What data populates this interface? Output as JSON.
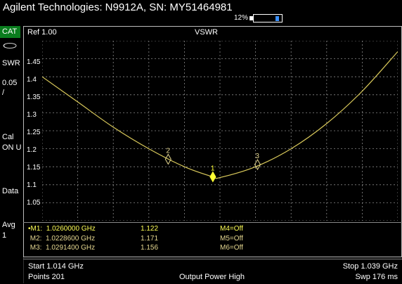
{
  "header": {
    "title": "Agilent Technologies: N9912A, SN: MY51464981",
    "battery_percent": "12%",
    "battery_level": 0.12
  },
  "sidebar": {
    "mode": "CAT",
    "items": [
      "SWR",
      "0.05",
      "/",
      "Cal",
      "ON U",
      "Data",
      "Avg",
      "1"
    ]
  },
  "plot": {
    "ref_label": "Ref 1.00",
    "trace_label": "VSWR",
    "y_ticks": [
      "1.45",
      "1.4",
      "1.35",
      "1.3",
      "1.25",
      "1.2",
      "1.15",
      "1.1",
      "1.05"
    ],
    "marker_labels": [
      "1",
      "2",
      "3"
    ]
  },
  "chart_data": {
    "type": "line",
    "title": "",
    "xlabel": "",
    "ylabel": "VSWR",
    "xlim": [
      1.014,
      1.039
    ],
    "ylim": [
      1.0,
      1.5
    ],
    "grid": true,
    "x_unit": "GHz",
    "series": [
      {
        "x": [
          1.014,
          1.0165,
          1.019,
          1.0215,
          1.024,
          1.026,
          1.0265,
          1.029,
          1.0315,
          1.034,
          1.0365,
          1.039
        ],
        "values": [
          1.4,
          1.33,
          1.26,
          1.2,
          1.15,
          1.122,
          1.12,
          1.15,
          1.2,
          1.27,
          1.36,
          1.47
        ]
      }
    ],
    "markers": [
      {
        "label": "1",
        "x": 1.026,
        "y": 1.122
      },
      {
        "label": "2",
        "x": 1.02286,
        "y": 1.171
      },
      {
        "label": "3",
        "x": 1.02914,
        "y": 1.156
      }
    ],
    "trace_color": "#d8c85a",
    "marker_color": "#ffff33"
  },
  "markers_table": [
    {
      "name": "M1:",
      "freq": "1.0260000 GHz",
      "value": "1.122",
      "other": "M4=Off",
      "active": true
    },
    {
      "name": "M2:",
      "freq": "1.0228600 GHz",
      "value": "1.171",
      "other": "M5=Off",
      "active": false
    },
    {
      "name": "M3:",
      "freq": "1.0291400 GHz",
      "value": "1.156",
      "other": "M6=Off",
      "active": false
    }
  ],
  "footer": {
    "start": "Start 1.014 GHz",
    "stop": "Stop 1.039 GHz",
    "points": "Points 201",
    "power": "Output Power High",
    "sweep": "Swp 176 ms"
  }
}
